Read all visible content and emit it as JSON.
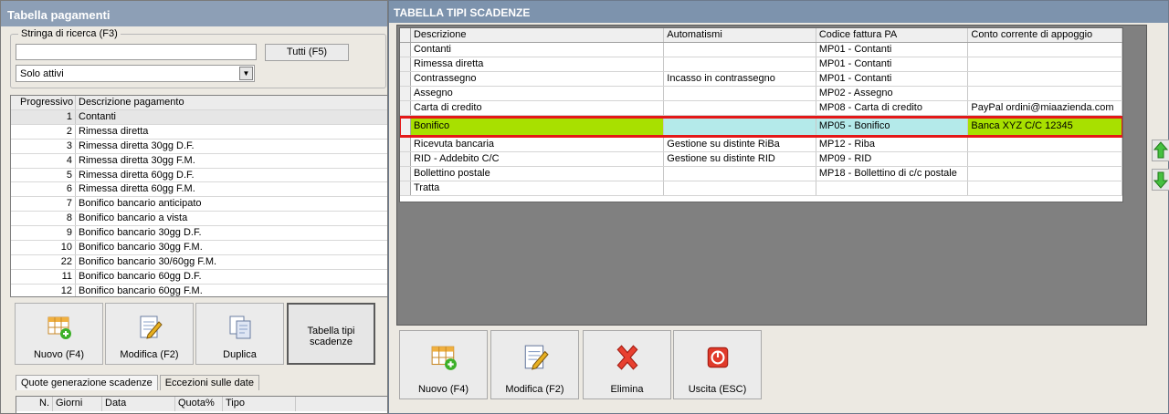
{
  "left": {
    "title": "Tabella pagamenti",
    "search_legend": "Stringa di ricerca (F3)",
    "search_value": "",
    "tutti_label": "Tutti (F5)",
    "filter_value": "Solo attivi",
    "table": {
      "headers": [
        "Progressivo",
        "Descrizione pagamento"
      ],
      "rows": [
        [
          "1",
          "Contanti"
        ],
        [
          "2",
          "Rimessa diretta"
        ],
        [
          "3",
          "Rimessa diretta 30gg D.F."
        ],
        [
          "4",
          "Rimessa diretta 30gg F.M."
        ],
        [
          "5",
          "Rimessa diretta 60gg D.F."
        ],
        [
          "6",
          "Rimessa diretta 60gg F.M."
        ],
        [
          "7",
          "Bonifico bancario anticipato"
        ],
        [
          "8",
          "Bonifico bancario a vista"
        ],
        [
          "9",
          "Bonifico bancario 30gg D.F."
        ],
        [
          "10",
          "Bonifico bancario 30gg F.M."
        ],
        [
          "22",
          "Bonifico bancario 30/60gg F.M."
        ],
        [
          "11",
          "Bonifico bancario 60gg D.F."
        ],
        [
          "12",
          "Bonifico bancario 60gg F.M."
        ]
      ]
    },
    "buttons": {
      "nuovo": "Nuovo (F4)",
      "modifica": "Modifica (F2)",
      "duplica": "Duplica",
      "tabella_tipi_line1": "Tabella tipi",
      "tabella_tipi_line2": "scadenze"
    },
    "tabs": [
      "Quote generazione scadenze",
      "Eccezioni sulle date"
    ],
    "bottom_headers": [
      "N.",
      "Giorni",
      "Data",
      "Quota%",
      "Tipo"
    ]
  },
  "right": {
    "title": "TABELLA TIPI SCADENZE",
    "grid": {
      "headers": [
        "Descrizione",
        "Automatismi",
        "Codice fattura PA",
        "Conto corrente di appoggio"
      ],
      "rows": [
        [
          "Contanti",
          "",
          "MP01 - Contanti",
          ""
        ],
        [
          "Rimessa diretta",
          "",
          "MP01 - Contanti",
          ""
        ],
        [
          "Contrassegno",
          "Incasso in contrassegno",
          "MP01 - Contanti",
          ""
        ],
        [
          "Assegno",
          "",
          "MP02 - Assegno",
          ""
        ],
        [
          "Carta di credito",
          "",
          "MP08 - Carta di credito",
          "PayPal ordini@miaazienda.com"
        ],
        [
          "Bonifico",
          "",
          "MP05 - Bonifico",
          "Banca XYZ C/C 12345"
        ],
        [
          "Ricevuta bancaria",
          "Gestione su distinte RiBa",
          "MP12 - Riba",
          ""
        ],
        [
          "RID - Addebito C/C",
          "Gestione su distinte RID",
          "MP09 - RID",
          ""
        ],
        [
          "Bollettino postale",
          "",
          "MP18 - Bollettino di c/c postale",
          ""
        ],
        [
          "Tratta",
          "",
          "",
          ""
        ]
      ],
      "highlighted_row": 5
    },
    "buttons": {
      "nuovo": "Nuovo (F4)",
      "modifica": "Modifica (F2)",
      "elimina": "Elimina",
      "uscita": "Uscita (ESC)"
    }
  },
  "colors": {
    "highlight_green": "#a8e000",
    "highlight_cyan": "#b4eaea",
    "highlight_border": "#e41818",
    "titlebar": "#7d93ad"
  }
}
